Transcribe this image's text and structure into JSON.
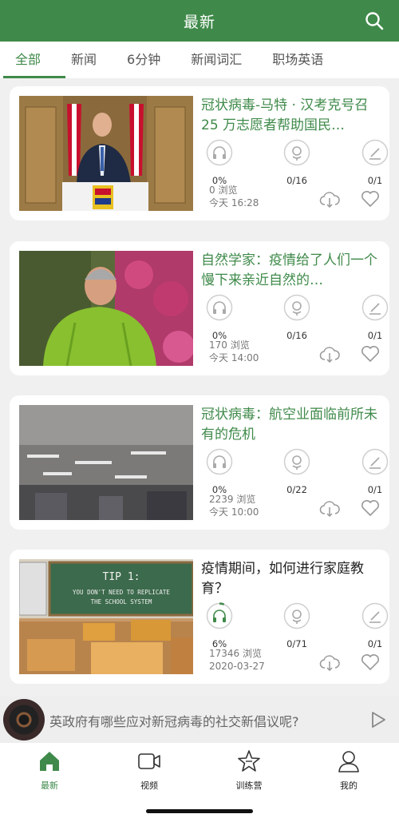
{
  "header": {
    "title": "最新"
  },
  "tabs": [
    "全部",
    "新闻",
    "6分钟",
    "新闻词汇",
    "职场英语"
  ],
  "articles": [
    {
      "title": "冠状病毒-马特 · 汉考克号召 25 万志愿者帮助国民…",
      "listen": "0%",
      "speak": "0/16",
      "quiz": "0/1",
      "views": "0 浏览",
      "date": "今天 16:28",
      "listen_progress": 0,
      "title_color": "green"
    },
    {
      "title": "自然学家：疫情给了人们一个慢下来亲近自然的…",
      "listen": "0%",
      "speak": "0/16",
      "quiz": "0/1",
      "views": "170 浏览",
      "date": "今天 14:00",
      "listen_progress": 0,
      "title_color": "green"
    },
    {
      "title": "冠状病毒：航空业面临前所未有的危机",
      "listen": "0%",
      "speak": "0/22",
      "quiz": "0/1",
      "views": "2239 浏览",
      "date": "今天 10:00",
      "listen_progress": 0,
      "title_color": "green"
    },
    {
      "title": "疫情期间，如何进行家庭教育？",
      "listen": "6%",
      "speak": "0/71",
      "quiz": "0/1",
      "views": "17346 浏览",
      "date": "2020-03-27",
      "listen_progress": 0.06,
      "title_color": "dark",
      "thumb_text_1": "TIP 1:",
      "thumb_text_2": "YOU DON'T NEED TO REPLICATE",
      "thumb_text_3": "THE SCHOOL SYSTEM"
    }
  ],
  "player": {
    "text": "英政府有哪些应对新冠病毒的社交新倡议呢?"
  },
  "bottom_nav": [
    {
      "label": "最新",
      "icon": "home-icon"
    },
    {
      "label": "视频",
      "icon": "video-icon"
    },
    {
      "label": "训练营",
      "icon": "star-icon"
    },
    {
      "label": "我的",
      "icon": "person-icon"
    }
  ],
  "colors": {
    "brand": "#3f8a4a"
  }
}
